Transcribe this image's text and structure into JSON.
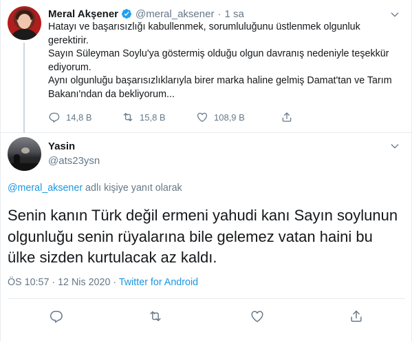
{
  "parent_tweet": {
    "author_name": "Meral Akşener",
    "handle": "@meral_aksener",
    "separator": "·",
    "time": "1 sa",
    "lines": [
      "Hatayı ve başarısızlığı kabullenmek, sorumluluğunu üstlenmek olgunluk gerektirir.",
      "Sayın Süleyman Soylu'ya göstermiş olduğu olgun davranış nedeniyle teşekkür ediyorum.",
      "Aynı olgunluğu başarısızlıklarıyla birer marka haline gelmiş Damat'tan ve Tarım Bakanı'ndan da bekliyorum..."
    ],
    "replies": "14,8 B",
    "retweets": "15,8 B",
    "likes": "108,9 B"
  },
  "reply_tweet": {
    "author_name": "Yasin",
    "handle": "@ats23ysn",
    "replying_mention": "@meral_aksener",
    "replying_suffix": " adlı kişiye yanıt olarak",
    "text": "Senin kanın Türk değil ermeni yahudi kanı Sayın soylunun olgunluğu senin rüyalarına bile gelemez vatan haini bu ülke sizden kurtulacak az kaldı.",
    "timestamp": "ÖS 10:57 · 12 Nis 2020 · ",
    "source": "Twitter for Android"
  },
  "colors": {
    "accent": "#1b95e0",
    "secondary_text": "#657786",
    "icon": "#657786",
    "divider": "#e6ecf0"
  },
  "icons": [
    "verified-badge-icon",
    "chevron-down-icon",
    "reply-icon",
    "retweet-icon",
    "like-icon",
    "share-icon"
  ]
}
